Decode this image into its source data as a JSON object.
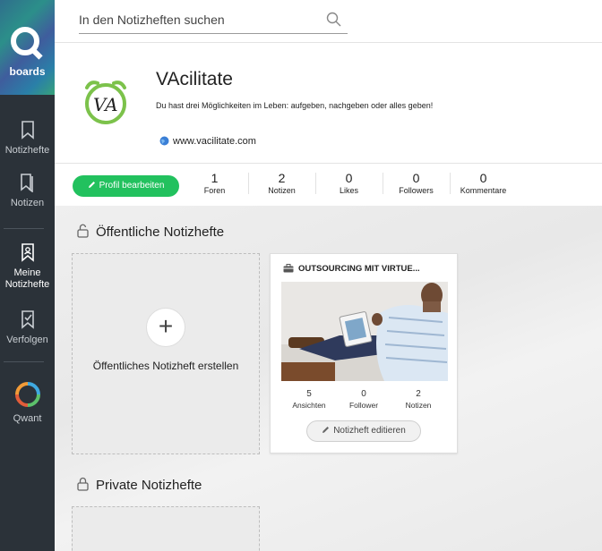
{
  "sidebar": {
    "logo_text": "boards",
    "items": [
      {
        "label": "Notizhefte",
        "icon": "bookmark-icon"
      },
      {
        "label": "Notizen",
        "icon": "double-bookmark-icon"
      },
      {
        "label": "Meine Notizhefte",
        "icon": "my-notebooks-icon"
      },
      {
        "label": "Verfolgen",
        "icon": "follow-icon"
      },
      {
        "label": "Qwant",
        "icon": "qwant-logo-icon"
      }
    ]
  },
  "search": {
    "placeholder": "In den Notizheften suchen"
  },
  "profile": {
    "name": "VAcilitate",
    "description": "Du hast drei Möglichkeiten im Leben: aufgeben, nachgeben oder alles geben!",
    "website": "www.vacilitate.com",
    "edit_label": "Profil bearbeiten",
    "stats": [
      {
        "value": "1",
        "label": "Foren"
      },
      {
        "value": "2",
        "label": "Notizen"
      },
      {
        "value": "0",
        "label": "Likes"
      },
      {
        "value": "0",
        "label": "Followers"
      },
      {
        "value": "0",
        "label": "Kommentare"
      }
    ]
  },
  "public_section": {
    "title": "Öffentliche Notizhefte",
    "create_label": "Öffentliches Notizheft erstellen"
  },
  "board": {
    "title": "OUTSOURCING MIT VIRTUE...",
    "stats": [
      {
        "value": "5",
        "label": "Ansichten"
      },
      {
        "value": "0",
        "label": "Follower"
      },
      {
        "value": "2",
        "label": "Notizen"
      }
    ],
    "edit_label": "Notizheft editieren"
  },
  "private_section": {
    "title": "Private Notizhefte"
  },
  "colors": {
    "sidebar_bg": "#2b3239",
    "accent_green": "#22c15e"
  }
}
